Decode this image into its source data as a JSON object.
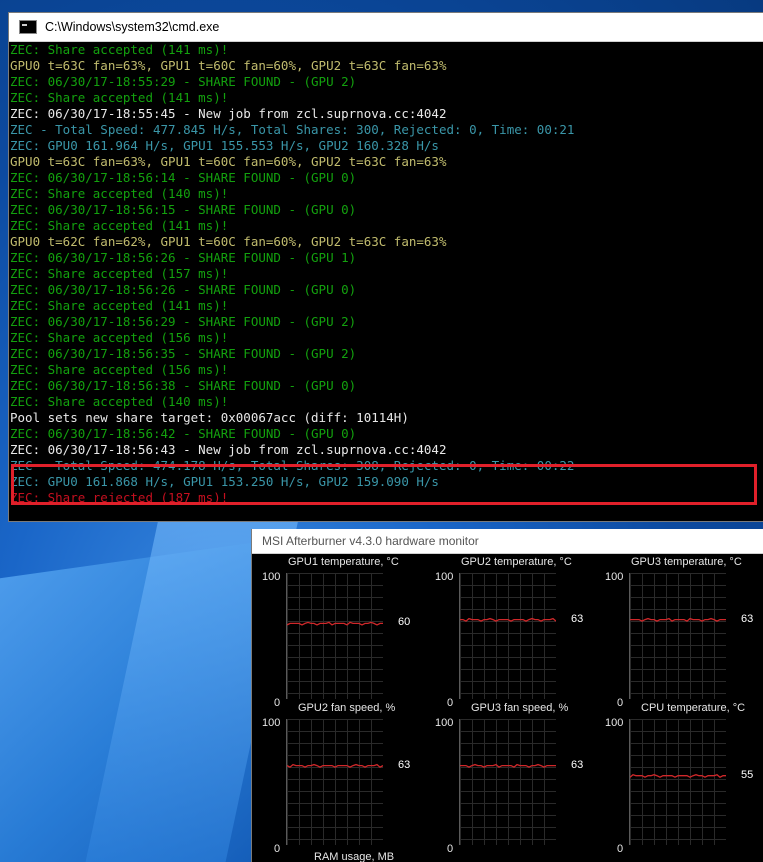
{
  "cmd": {
    "title": "C:\\Windows\\system32\\cmd.exe",
    "lines": [
      {
        "text": "ZEC: Share accepted (141 ms)!",
        "color": "green"
      },
      {
        "text": "GPU0 t=63C fan=63%, GPU1 t=60C fan=60%, GPU2 t=63C fan=63%",
        "color": "yellow"
      },
      {
        "text": "ZEC: 06/30/17-18:55:29 - SHARE FOUND - (GPU 2)",
        "color": "green"
      },
      {
        "text": "ZEC: Share accepted (141 ms)!",
        "color": "green"
      },
      {
        "text": "ZEC: 06/30/17-18:55:45 - New job from zcl.suprnova.cc:4042",
        "color": "white"
      },
      {
        "text": "ZEC - Total Speed: 477.845 H/s, Total Shares: 300, Rejected: 0, Time: 00:21",
        "color": "cyan"
      },
      {
        "text": "ZEC: GPU0 161.964 H/s, GPU1 155.553 H/s, GPU2 160.328 H/s",
        "color": "cyan"
      },
      {
        "text": "GPU0 t=63C fan=63%, GPU1 t=60C fan=60%, GPU2 t=63C fan=63%",
        "color": "yellow"
      },
      {
        "text": "ZEC: 06/30/17-18:56:14 - SHARE FOUND - (GPU 0)",
        "color": "green"
      },
      {
        "text": "ZEC: Share accepted (140 ms)!",
        "color": "green"
      },
      {
        "text": "ZEC: 06/30/17-18:56:15 - SHARE FOUND - (GPU 0)",
        "color": "green"
      },
      {
        "text": "ZEC: Share accepted (141 ms)!",
        "color": "green"
      },
      {
        "text": "GPU0 t=62C fan=62%, GPU1 t=60C fan=60%, GPU2 t=63C fan=63%",
        "color": "yellow"
      },
      {
        "text": "ZEC: 06/30/17-18:56:26 - SHARE FOUND - (GPU 1)",
        "color": "green"
      },
      {
        "text": "ZEC: Share accepted (157 ms)!",
        "color": "green"
      },
      {
        "text": "ZEC: 06/30/17-18:56:26 - SHARE FOUND - (GPU 0)",
        "color": "green"
      },
      {
        "text": "ZEC: Share accepted (141 ms)!",
        "color": "green"
      },
      {
        "text": "ZEC: 06/30/17-18:56:29 - SHARE FOUND - (GPU 2)",
        "color": "green"
      },
      {
        "text": "ZEC: Share accepted (156 ms)!",
        "color": "green"
      },
      {
        "text": "ZEC: 06/30/17-18:56:35 - SHARE FOUND - (GPU 2)",
        "color": "green"
      },
      {
        "text": "ZEC: Share accepted (156 ms)!",
        "color": "green"
      },
      {
        "text": "ZEC: 06/30/17-18:56:38 - SHARE FOUND - (GPU 0)",
        "color": "green"
      },
      {
        "text": "ZEC: Share accepted (140 ms)!",
        "color": "green"
      },
      {
        "text": "Pool sets new share target: 0x00067acc (diff: 10114H)",
        "color": "white"
      },
      {
        "text": "ZEC: 06/30/17-18:56:42 - SHARE FOUND - (GPU 0)",
        "color": "green"
      },
      {
        "text": "ZEC: 06/30/17-18:56:43 - New job from zcl.suprnova.cc:4042",
        "color": "white"
      },
      {
        "text": "ZEC - Total Speed: 474.178 H/s, Total Shares: 308, Rejected: 0, Time: 00:22",
        "color": "cyan"
      },
      {
        "text": "ZEC: GPU0 161.868 H/s, GPU1 153.250 H/s, GPU2 159.090 H/s",
        "color": "cyan"
      },
      {
        "text": "ZEC: Share rejected (187 ms)!",
        "color": "red"
      }
    ]
  },
  "afterburner": {
    "title": "MSI Afterburner v4.3.0 hardware monitor",
    "line_color": "#d0282a",
    "graphs": [
      {
        "label": "GPU1 temperature, °C",
        "max": "100",
        "min": "0",
        "value": 60,
        "current": "60"
      },
      {
        "label": "GPU2 temperature, °C",
        "max": "100",
        "min": "0",
        "value": 63,
        "current": "63"
      },
      {
        "label": "GPU3 temperature, °C",
        "max": "100",
        "min": "0",
        "value": 63,
        "current": "63"
      },
      {
        "label": "GPU2 fan speed, %",
        "max": "100",
        "min": "0",
        "value": 63,
        "current": "63"
      },
      {
        "label": "GPU3 fan speed, %",
        "max": "100",
        "min": "0",
        "value": 63,
        "current": "63"
      },
      {
        "label": "CPU temperature, °C",
        "max": "100",
        "min": "0",
        "value": 55,
        "current": "55"
      }
    ],
    "next_graph_label": "RAM usage, MB"
  }
}
